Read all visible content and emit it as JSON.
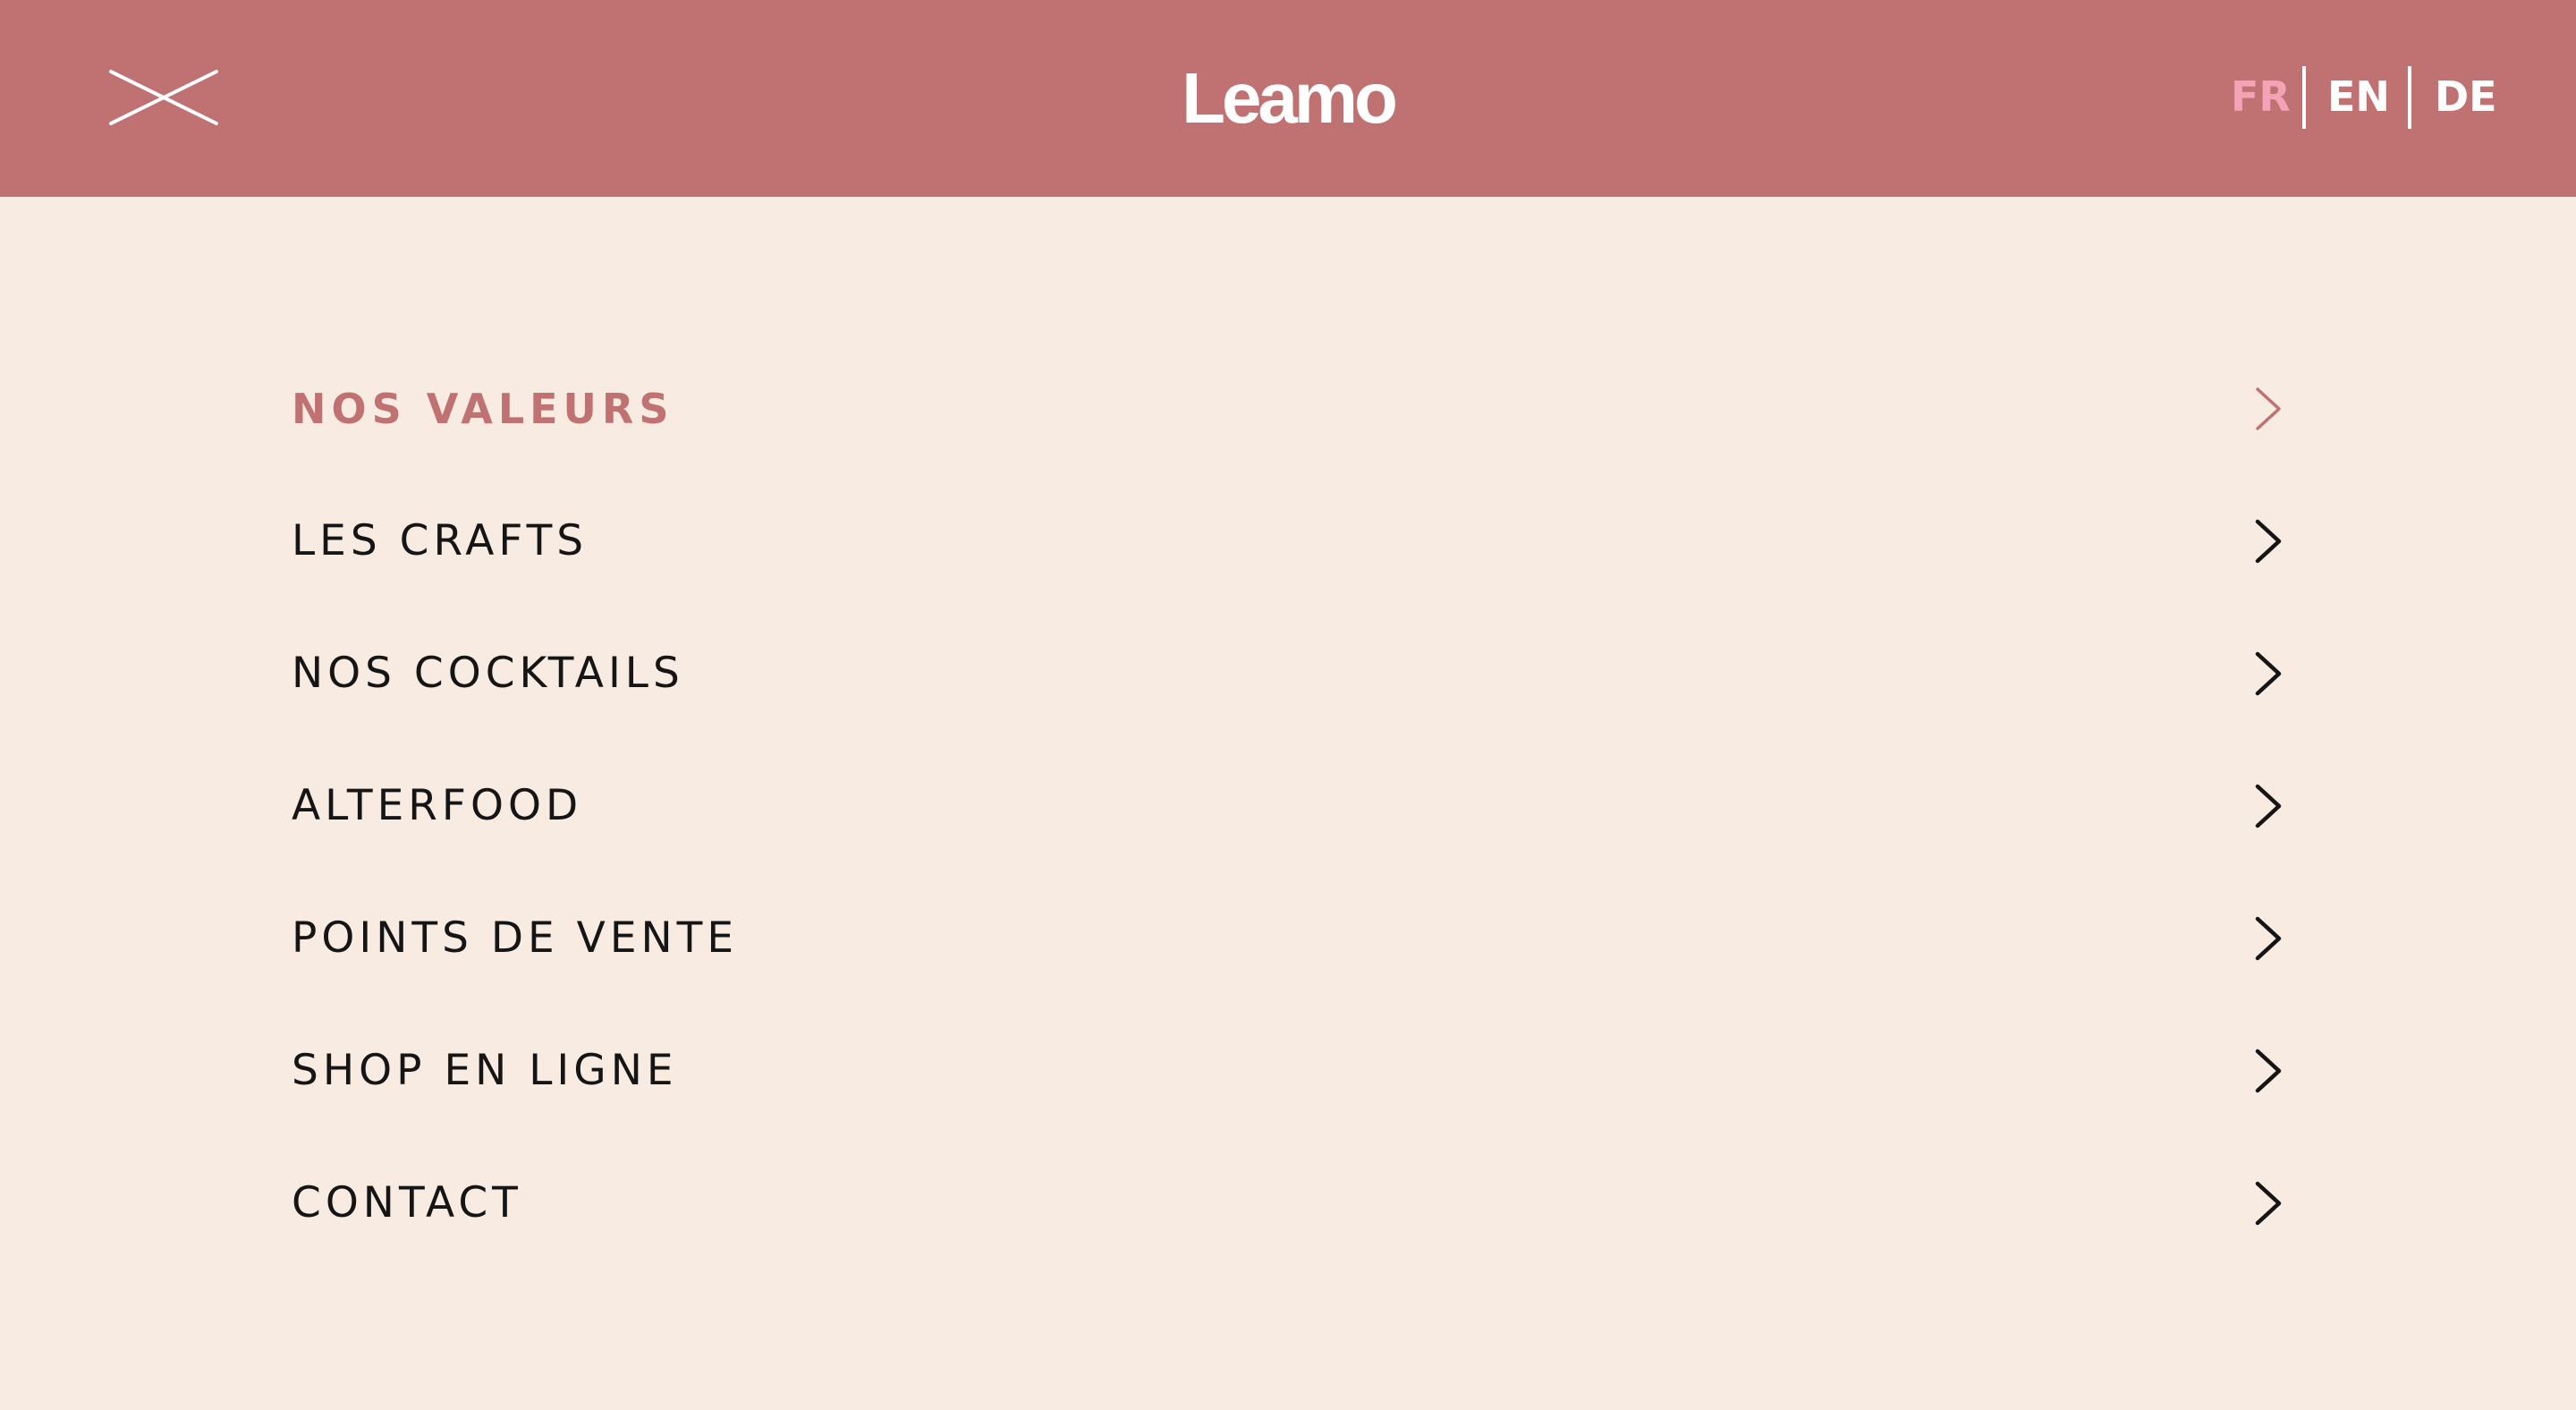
{
  "brand": {
    "logo_text": "Leamo",
    "colors": {
      "header_bg": "#c07272",
      "page_bg": "#f8ebe2",
      "active_lang": "#f2a4b6",
      "active_menu": "#c07272",
      "text": "#151515"
    }
  },
  "header": {
    "close_icon": "close-icon",
    "languages": [
      {
        "code": "FR",
        "active": true
      },
      {
        "code": "EN",
        "active": false
      },
      {
        "code": "DE",
        "active": false
      }
    ]
  },
  "menu": {
    "items": [
      {
        "label": "NOS VALEURS",
        "active": true,
        "icon": "chevron-right-icon"
      },
      {
        "label": "LES CRAFTS",
        "active": false,
        "icon": "chevron-right-icon"
      },
      {
        "label": "NOS COCKTAILS",
        "active": false,
        "icon": "chevron-right-icon"
      },
      {
        "label": "ALTERFOOD",
        "active": false,
        "icon": "chevron-right-icon"
      },
      {
        "label": "POINTS DE VENTE",
        "active": false,
        "icon": "chevron-right-icon"
      },
      {
        "label": "SHOP EN LIGNE",
        "active": false,
        "icon": "chevron-right-icon"
      },
      {
        "label": "CONTACT",
        "active": false,
        "icon": "chevron-right-icon"
      }
    ]
  }
}
